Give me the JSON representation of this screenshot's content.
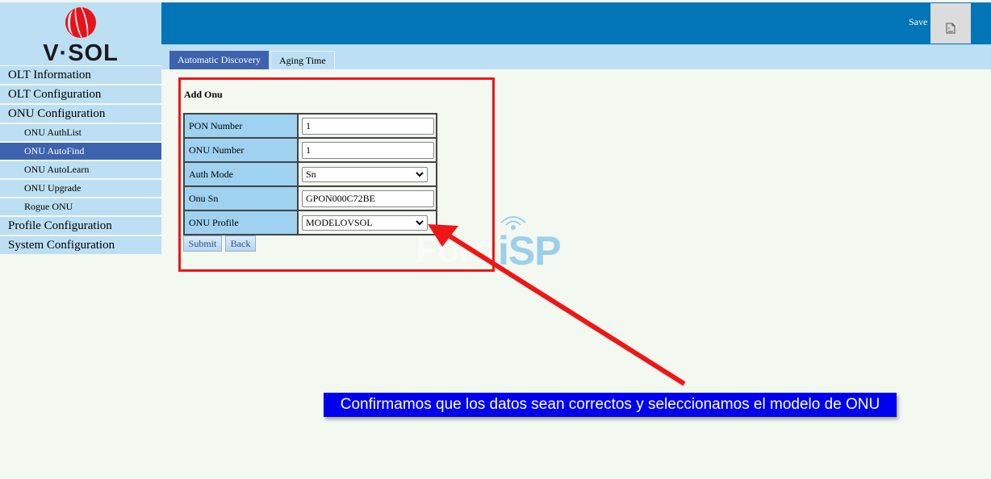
{
  "brand": {
    "name": "V·SOL",
    "logo_icon": "vsol-logo-icon"
  },
  "header": {
    "save_label": "Save",
    "save_icon": "broken-image-icon"
  },
  "tabs": [
    {
      "label": "Automatic Discovery",
      "active": true
    },
    {
      "label": "Aging Time",
      "active": false
    }
  ],
  "sidebar": {
    "items": [
      {
        "label": "OLT Information",
        "level": 1
      },
      {
        "label": "OLT Configuration",
        "level": 1
      },
      {
        "label": "ONU Configuration",
        "level": 1
      },
      {
        "label": "ONU AuthList",
        "level": 2
      },
      {
        "label": "ONU AutoFind",
        "level": 2,
        "active": true
      },
      {
        "label": "ONU AutoLearn",
        "level": 2
      },
      {
        "label": "ONU Upgrade",
        "level": 2
      },
      {
        "label": "Rogue ONU",
        "level": 2
      },
      {
        "label": "Profile Configuration",
        "level": 1
      },
      {
        "label": "System Configuration",
        "level": 1
      }
    ]
  },
  "form": {
    "title": "Add Onu",
    "fields": [
      {
        "label": "PON Number",
        "type": "text",
        "value": "1"
      },
      {
        "label": "ONU Number",
        "type": "text",
        "value": "1"
      },
      {
        "label": "Auth Mode",
        "type": "select",
        "value": "Sn"
      },
      {
        "label": "Onu Sn",
        "type": "text",
        "value": "GPON000C72BE"
      },
      {
        "label": "ONU Profile",
        "type": "select",
        "value": "MODELOVSOL"
      }
    ],
    "submit_label": "Submit",
    "back_label": "Back"
  },
  "annotation": {
    "caption": "Confirmamos que los datos sean correctos y seleccionamos el modelo de ONU",
    "highlight_color": "#f01616",
    "caption_bg": "#0000f0"
  },
  "watermark": {
    "part1": "Foro",
    "part2": "iSP"
  }
}
